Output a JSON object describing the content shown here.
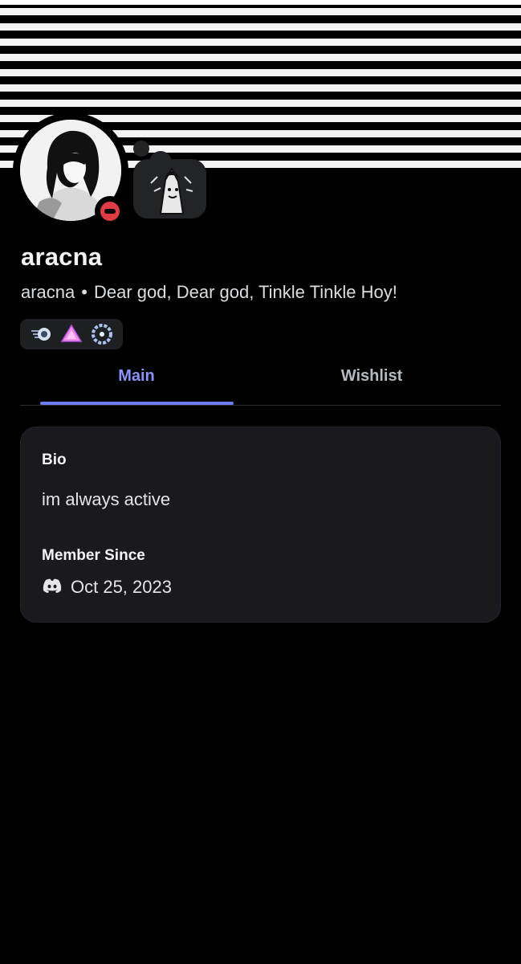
{
  "profile": {
    "display_name": "aracna",
    "username": "aracna",
    "separator": "•",
    "pronouns_status": "Dear god, Dear god, Tinkle Tinkle Hoy!",
    "status": "do-not-disturb"
  },
  "badges": [
    {
      "icon": "hypesquad-speed-icon"
    },
    {
      "icon": "pink-triangle-icon"
    },
    {
      "icon": "laurel-badge-icon"
    }
  ],
  "tabs": {
    "main": "Main",
    "wishlist": "Wishlist",
    "active": "main"
  },
  "card": {
    "bio_label": "Bio",
    "bio_text": "im always active",
    "member_since_label": "Member Since",
    "member_since_date": "Oct 25, 2023"
  },
  "colors": {
    "accent": "#8b93f8",
    "dnd": "#e03c45",
    "card_bg": "#1a1a1e"
  }
}
